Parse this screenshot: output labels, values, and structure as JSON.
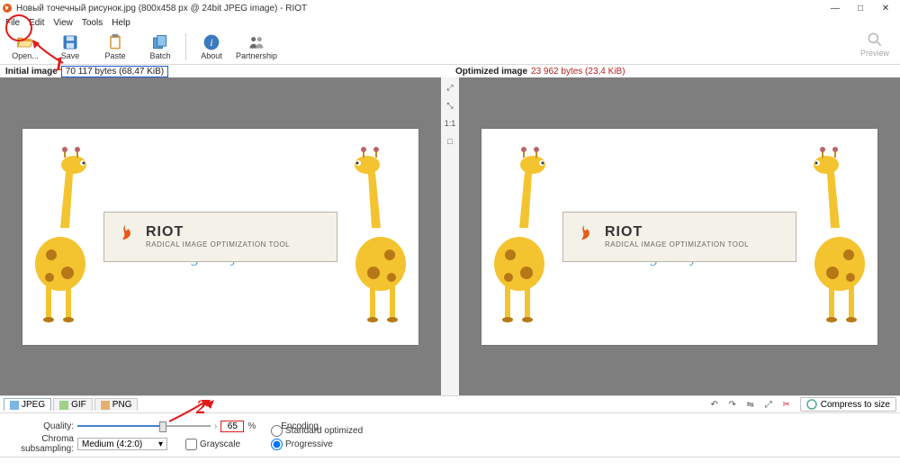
{
  "window": {
    "title": "Новый точечный рисунок.jpg (800x458 px @ 24bit JPEG image) - RIOT",
    "min": "—",
    "max": "□",
    "close": "✕"
  },
  "menu": {
    "file": "File",
    "edit": "Edit",
    "view": "View",
    "tools": "Tools",
    "help": "Help"
  },
  "toolbar": {
    "open": "Open...",
    "save": "Save",
    "paste": "Paste",
    "batch": "Batch",
    "about": "About",
    "partnership": "Partnership",
    "preview": "Preview"
  },
  "info": {
    "initial_label": "Initial image",
    "initial_bytes": "70 117 bytes (68,47 KiB)",
    "optimized_label": "Optimized image",
    "optimized_bytes": "23 962 bytes (23,4 KiB)"
  },
  "midtools": {
    "zoomin": "⤢",
    "zoomout": "⤡",
    "fit": "1:1",
    "full": "□"
  },
  "sign": {
    "brand": "RIOT",
    "sub": "RADICAL IMAGE OPTIMIZATION TOOL"
  },
  "watermark": "blogostrojka.ru",
  "tabs": {
    "jpeg": "JPEG",
    "gif": "GIF",
    "png": "PNG"
  },
  "righttools": {
    "rotl": "↶",
    "rotr": "↷",
    "flip": "⇋",
    "resize": "⤢",
    "wrench": "✂",
    "compress": "Compress to size"
  },
  "settings": {
    "quality_label": "Quality:",
    "quality_value": "65",
    "percent": "%",
    "chroma_label": "Chroma subsampling:",
    "chroma_value": "Medium (4:2:0)",
    "grayscale": "Grayscale",
    "encoding_label": "Encoding",
    "standard": "Standard optimized",
    "progressive": "Progressive"
  },
  "annot": {
    "a1": "1",
    "a2": "2"
  },
  "status": ""
}
